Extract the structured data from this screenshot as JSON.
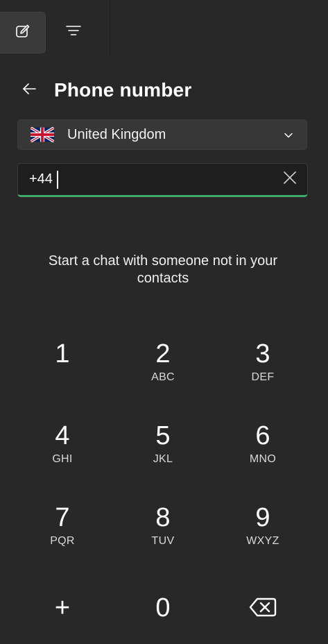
{
  "toolbar": {
    "compose_icon": "compose-icon",
    "filter_icon": "filter-icon"
  },
  "header": {
    "back_icon": "arrow-left-icon",
    "title": "Phone number"
  },
  "country_select": {
    "flag_icon": "uk-flag-icon",
    "selected": "United Kingdom",
    "chevron_icon": "chevron-down-icon"
  },
  "phone_input": {
    "value": "+44",
    "clear_icon": "close-icon",
    "focus_color": "#3fa86b"
  },
  "hint": "Start a chat with someone not in your contacts",
  "keypad": {
    "keys": [
      {
        "digit": "1",
        "letters": ""
      },
      {
        "digit": "2",
        "letters": "ABC"
      },
      {
        "digit": "3",
        "letters": "DEF"
      },
      {
        "digit": "4",
        "letters": "GHI"
      },
      {
        "digit": "5",
        "letters": "JKL"
      },
      {
        "digit": "6",
        "letters": "MNO"
      },
      {
        "digit": "7",
        "letters": "PQR"
      },
      {
        "digit": "8",
        "letters": "TUV"
      },
      {
        "digit": "9",
        "letters": "WXYZ"
      },
      {
        "digit": "+",
        "letters": ""
      },
      {
        "digit": "0",
        "letters": ""
      }
    ],
    "backspace_icon": "backspace-icon"
  }
}
